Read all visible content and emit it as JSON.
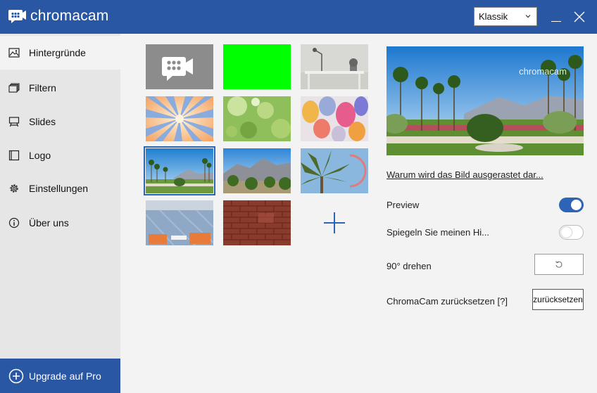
{
  "app": {
    "title": "chromacam"
  },
  "header": {
    "mode_value": "Klassik"
  },
  "sidebar": {
    "items": [
      {
        "label": "Hintergründe",
        "icon": "image-icon"
      },
      {
        "label": "Filtern",
        "icon": "layers-icon"
      },
      {
        "label": "Slides",
        "icon": "easel-icon"
      },
      {
        "label": "Logo",
        "icon": "square-icon"
      },
      {
        "label": "Einstellungen",
        "icon": "gear-icon"
      },
      {
        "label": "Über uns",
        "icon": "info-icon"
      }
    ],
    "upgrade_label": "Upgrade auf Pro"
  },
  "backgrounds": {
    "tiles": [
      "chromacam-logo",
      "green-screen",
      "office-desk",
      "sunburst",
      "bokeh-green",
      "balloons",
      "palm-park",
      "desert-mountains",
      "palm-sky",
      "office-room",
      "brick-wall"
    ],
    "selected_index": 6,
    "colors": {
      "green_screen": "#00ff00",
      "accent": "#2e64b5"
    }
  },
  "panel": {
    "preview_watermark": "chromacam",
    "why_link": "Warum wird das Bild ausgerastet dar...",
    "preview_label": "Preview",
    "preview_on": true,
    "mirror_label": "Spiegeln Sie meinen Hi...",
    "mirror_on": false,
    "rotate_label": "90° drehen",
    "reset_label": "ChromaCam zurücksetzen [?]",
    "reset_button": "zurücksetzen"
  }
}
